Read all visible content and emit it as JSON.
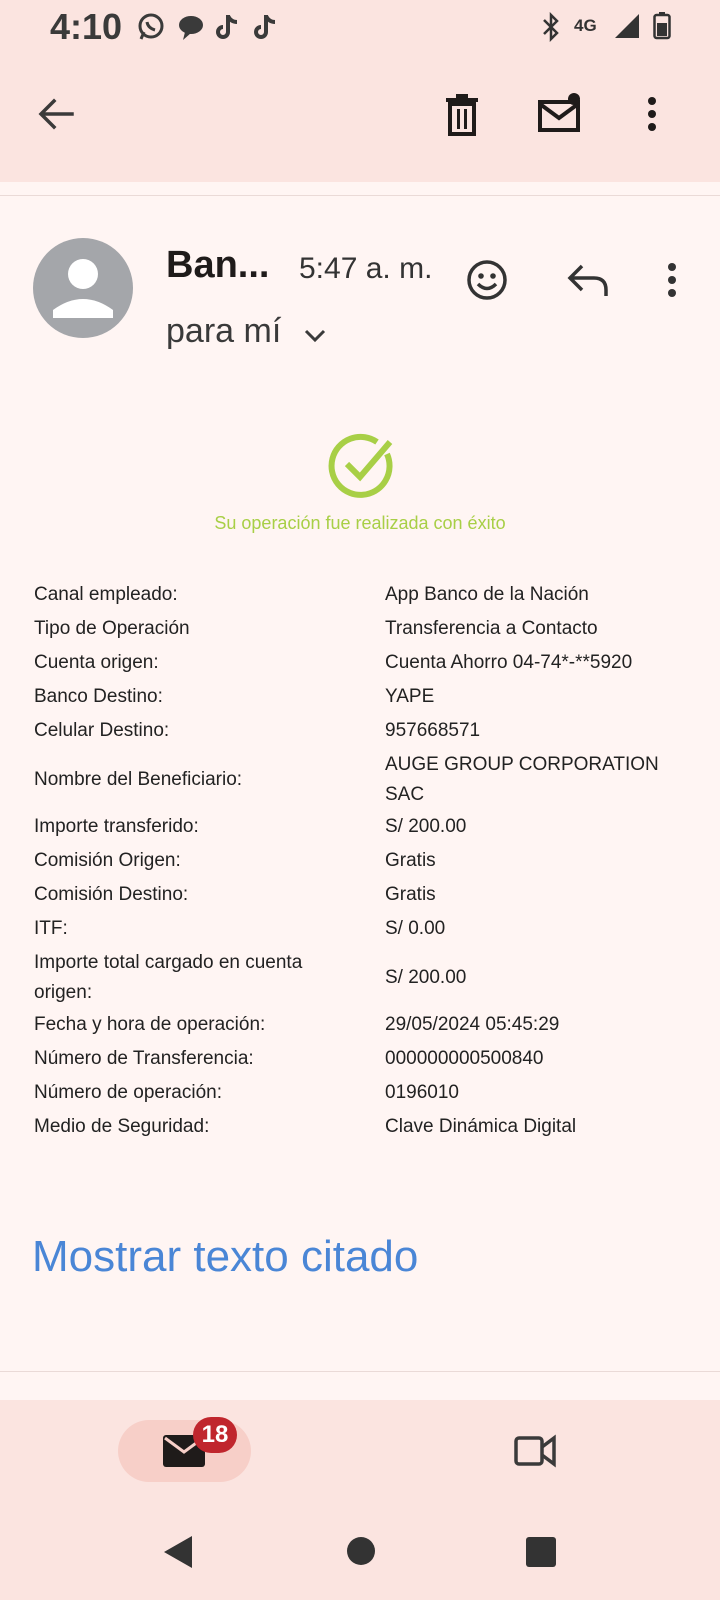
{
  "status_bar": {
    "time": "4:10",
    "network": "4G",
    "left_icons": [
      "whatsapp-icon",
      "chat-bubble-icon",
      "tiktok-icon",
      "tiktok-icon"
    ],
    "right_icons": [
      "bluetooth-icon",
      "signal-icon",
      "battery-icon"
    ]
  },
  "toolbar": {
    "icons": [
      "back-arrow-icon",
      "trash-icon",
      "mark-unread-icon",
      "more-vert-icon"
    ]
  },
  "email": {
    "sender": "Ban...",
    "time": "5:47 a. m.",
    "recipient": "para mí",
    "success_message": "Su operación fue realizada con éxito",
    "details": [
      {
        "label": "Canal empleado:",
        "value": "App Banco de la Nación"
      },
      {
        "label": "Tipo de Operación",
        "value": "Transferencia a Contacto"
      },
      {
        "label": "Cuenta origen:",
        "value": "Cuenta Ahorro 04-74*-**5920"
      },
      {
        "label": "Banco Destino:",
        "value": "YAPE"
      },
      {
        "label": "Celular Destino:",
        "value": "957668571"
      },
      {
        "label": "Nombre del Beneficiario:",
        "value": "AUGE GROUP CORPORATION SAC"
      },
      {
        "label": "Importe transferido:",
        "value": "S/ 200.00"
      },
      {
        "label": "Comisión Origen:",
        "value": "Gratis"
      },
      {
        "label": "Comisión Destino:",
        "value": "Gratis"
      },
      {
        "label": "ITF:",
        "value": "S/ 0.00"
      },
      {
        "label": "Importe total cargado en cuenta origen:",
        "value": "S/ 200.00"
      },
      {
        "label": "Fecha y hora de operación:",
        "value": "29/05/2024 05:45:29"
      },
      {
        "label": "Número de Transferencia:",
        "value": "000000000500840"
      },
      {
        "label": "Número de operación:",
        "value": "0196010"
      },
      {
        "label": "Medio de Seguridad:",
        "value": "Clave Dinámica Digital"
      }
    ],
    "show_quoted": "Mostrar texto citado"
  },
  "bottom_nav": {
    "mail_badge": "18"
  },
  "colors": {
    "header_bg": "#fbe4e0",
    "page_bg": "#fff5f3",
    "success_green": "#a8cf46",
    "link_blue": "#4a86d6",
    "badge_red": "#c0262d"
  }
}
